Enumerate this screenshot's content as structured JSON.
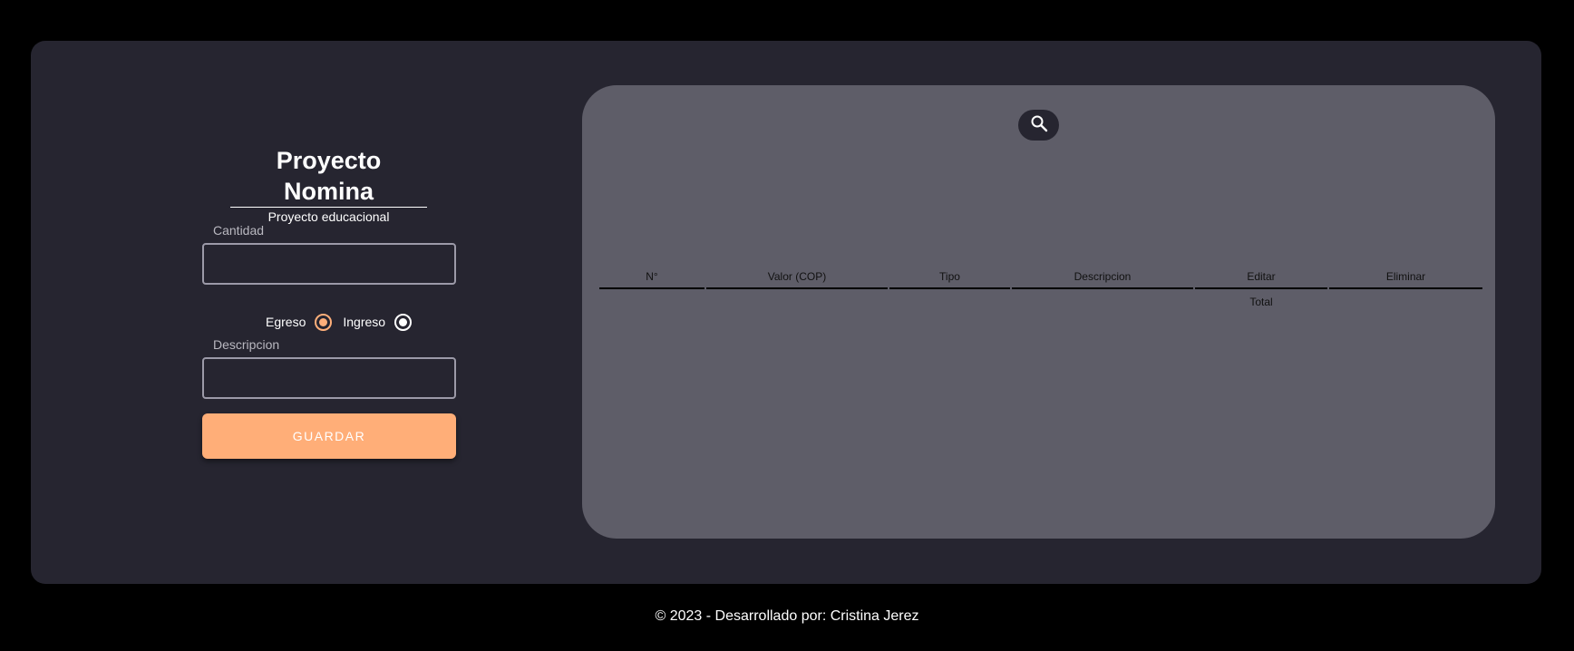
{
  "brand": {
    "title": "Proyecto Nomina",
    "subtitle": "Proyecto educacional"
  },
  "form": {
    "cantidad_label": "Cantidad",
    "cantidad_value": "",
    "descripcion_label": "Descripcion",
    "descripcion_value": "",
    "radio_options": [
      {
        "label": "Egreso",
        "selected": true
      },
      {
        "label": "Ingreso",
        "selected": false
      }
    ],
    "save_label": "GUARDAR"
  },
  "table": {
    "search_icon": "search-icon",
    "columns": [
      "N°",
      "Valor (COP)",
      "Tipo",
      "Descripcion",
      "Editar",
      "Eliminar"
    ],
    "rows": [],
    "total_label": "Total"
  },
  "footer": {
    "text": "© 2023 - Desarrollado por: Cristina Jerez"
  },
  "colors": {
    "background": "#000000",
    "card": "#262530",
    "panel": "#5e5d68",
    "accent": "#ffae78"
  }
}
